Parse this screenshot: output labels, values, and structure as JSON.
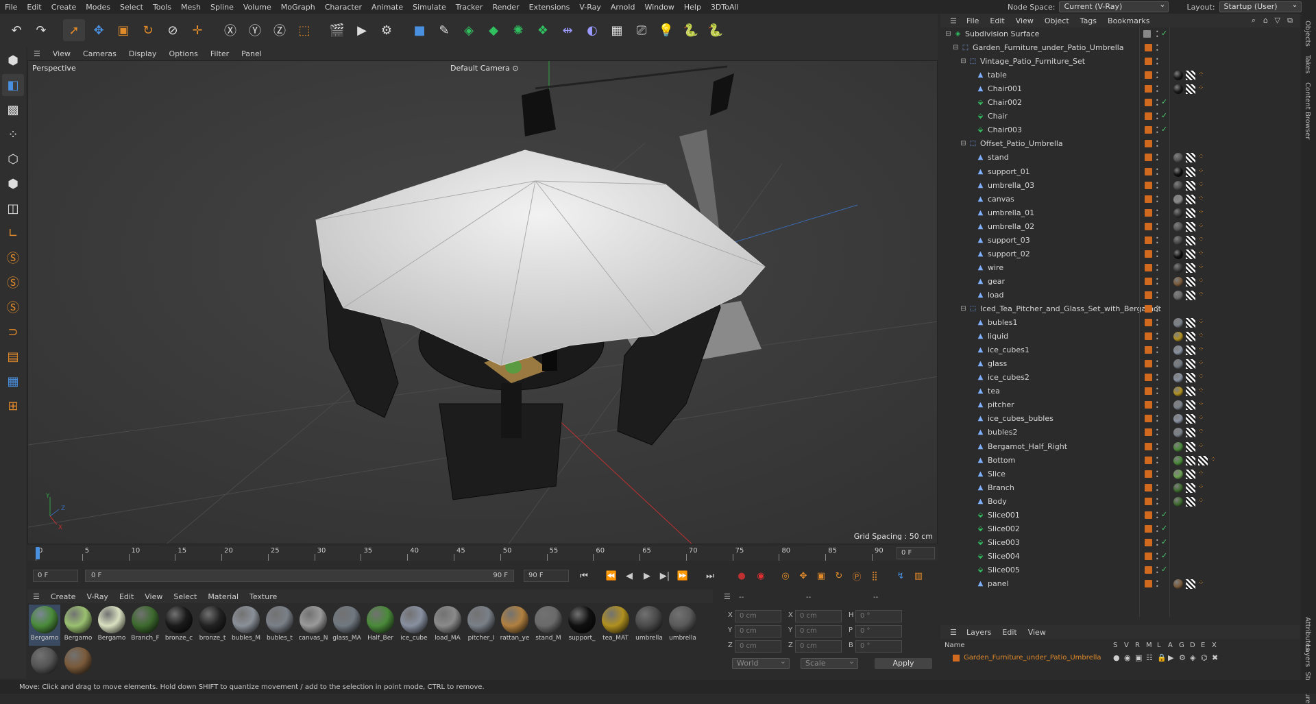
{
  "menubar": {
    "items": [
      "File",
      "Edit",
      "Create",
      "Modes",
      "Select",
      "Tools",
      "Mesh",
      "Spline",
      "Volume",
      "MoGraph",
      "Character",
      "Animate",
      "Simulate",
      "Tracker",
      "Render",
      "Extensions",
      "V-Ray",
      "Arnold",
      "Window",
      "Help",
      "3DToAll"
    ],
    "node_space_label": "Node Space:",
    "node_space_value": "Current (V-Ray)",
    "layout_label": "Layout:",
    "layout_value": "Startup (User)"
  },
  "toolbar": {
    "icons": [
      "undo-icon",
      "redo-icon",
      "select-arrow-icon",
      "move-icon",
      "scale-icon",
      "rotate-icon",
      "recent-tool-icon",
      "add-icon",
      "x-axis-icon",
      "y-axis-icon",
      "z-axis-icon",
      "coordinate-system-icon",
      "render-region-icon",
      "render-view-icon",
      "render-settings-icon",
      "cube-primitive-icon",
      "pen-spline-icon",
      "subdivision-icon",
      "extrude-icon",
      "cloner-icon",
      "array-icon",
      "symmetry-icon",
      "deformer-icon",
      "floor-icon",
      "camera-icon",
      "light-icon",
      "python-icon",
      "python-alt-icon"
    ]
  },
  "left_toolbar": {
    "icons": [
      "make-editable-icon",
      "model-mode-icon",
      "texture-mode-icon",
      "points-mode-icon",
      "edges-mode-icon",
      "polygons-mode-icon",
      "uv-mode-icon",
      "axis-mode-icon",
      "snap-s1-icon",
      "snap-s2-icon",
      "snap-s3-icon",
      "magnet-icon",
      "workplane-icon",
      "grid-icon",
      "lock-grid-icon"
    ]
  },
  "viewport_menu": {
    "items": [
      "View",
      "Cameras",
      "Display",
      "Options",
      "Filter",
      "Panel"
    ]
  },
  "viewport": {
    "view_name": "Perspective",
    "camera_name": "Default Camera",
    "grid_spacing": "Grid Spacing : 50 cm",
    "axis_labels": {
      "y": "Y",
      "z": "Z",
      "x": "X"
    }
  },
  "timeline": {
    "ticks": [
      "0",
      "5",
      "10",
      "15",
      "20",
      "25",
      "30",
      "35",
      "40",
      "45",
      "50",
      "55",
      "60",
      "65",
      "70",
      "75",
      "80",
      "85",
      "90"
    ],
    "current_frame": "0 F"
  },
  "transport": {
    "start_field": "0 F",
    "range_start": "0 F",
    "range_end": "90 F",
    "end_field": "90 F"
  },
  "material_menu": {
    "items": [
      "Create",
      "V-Ray",
      "Edit",
      "View",
      "Select",
      "Material",
      "Texture"
    ]
  },
  "materials": [
    {
      "name": "Bergamo",
      "color": "#4a8a3a"
    },
    {
      "name": "Bergamo",
      "color": "#9ac070"
    },
    {
      "name": "Bergamo",
      "color": "#d8e0c0"
    },
    {
      "name": "Branch_F",
      "color": "#3d6a2e"
    },
    {
      "name": "bronze_c",
      "color": "#1a1a1a"
    },
    {
      "name": "bronze_t",
      "color": "#222222"
    },
    {
      "name": "bubles_M",
      "color": "#8a9098"
    },
    {
      "name": "bubles_t",
      "color": "#7a8088"
    },
    {
      "name": "canvas_N",
      "color": "#9a9a9a"
    },
    {
      "name": "glass_MA",
      "color": "#707880"
    },
    {
      "name": "Half_Ber",
      "color": "#4a8a3a"
    },
    {
      "name": "ice_cube",
      "color": "#8890a0"
    },
    {
      "name": "load_MA",
      "color": "#8a8a8a"
    },
    {
      "name": "pitcher_I",
      "color": "#7a8088"
    },
    {
      "name": "rattan_ye",
      "color": "#b08040"
    },
    {
      "name": "stand_M",
      "color": "#6a6a6a"
    },
    {
      "name": "support_",
      "color": "#101010"
    },
    {
      "name": "tea_MAT",
      "color": "#b09020"
    },
    {
      "name": "umbrella",
      "color": "#4a4a4a"
    },
    {
      "name": "umbrella",
      "color": "#5a5a5a"
    },
    {
      "name": "",
      "color": "#555555"
    },
    {
      "name": "",
      "color": "#7a5a3a"
    }
  ],
  "coords": {
    "header": [
      "--",
      "--",
      "--"
    ],
    "rows": [
      {
        "a": "X",
        "av": "0 cm",
        "b": "X",
        "bv": "0 cm",
        "c": "H",
        "cv": "0 °"
      },
      {
        "a": "Y",
        "av": "0 cm",
        "b": "Y",
        "bv": "0 cm",
        "c": "P",
        "cv": "0 °"
      },
      {
        "a": "Z",
        "av": "0 cm",
        "b": "Z",
        "bv": "0 cm",
        "c": "B",
        "cv": "0 °"
      }
    ],
    "world": "World",
    "scale": "Scale",
    "apply": "Apply"
  },
  "status_text": "Move: Click and drag to move elements. Hold down SHIFT to quantize movement / add to the selection in point mode, CTRL to remove.",
  "object_menu": {
    "items": [
      "File",
      "Edit",
      "View",
      "Object",
      "Tags",
      "Bookmarks"
    ]
  },
  "objects": [
    {
      "name": "Subdivision Surface",
      "indent": 0,
      "type": "sds",
      "check": true,
      "tags": []
    },
    {
      "name": "Garden_Furniture_under_Patio_Umbrella",
      "indent": 1,
      "type": "null",
      "check": false,
      "tags": []
    },
    {
      "name": "Vintage_Patio_Furniture_Set",
      "indent": 2,
      "type": "null",
      "check": false,
      "tags": []
    },
    {
      "name": "table",
      "indent": 3,
      "type": "poly",
      "check": false,
      "tags": [
        "#1a1a1a"
      ]
    },
    {
      "name": "Chair001",
      "indent": 3,
      "type": "poly",
      "check": false,
      "tags": [
        "#1a1a1a"
      ]
    },
    {
      "name": "Chair002",
      "indent": 3,
      "type": "inst",
      "check": true,
      "tags": []
    },
    {
      "name": "Chair",
      "indent": 3,
      "type": "inst",
      "check": true,
      "tags": []
    },
    {
      "name": "Chair003",
      "indent": 3,
      "type": "inst",
      "check": true,
      "tags": []
    },
    {
      "name": "Offset_Patio_Umbrella",
      "indent": 2,
      "type": "null",
      "check": false,
      "tags": []
    },
    {
      "name": "stand",
      "indent": 3,
      "type": "poly",
      "check": false,
      "tags": [
        "#555555"
      ]
    },
    {
      "name": "support_01",
      "indent": 3,
      "type": "poly",
      "check": false,
      "tags": [
        "#111111"
      ]
    },
    {
      "name": "umbrella_03",
      "indent": 3,
      "type": "poly",
      "check": false,
      "tags": [
        "#4a4a4a"
      ]
    },
    {
      "name": "canvas",
      "indent": 3,
      "type": "poly",
      "check": false,
      "tags": [
        "#8a8a8a"
      ]
    },
    {
      "name": "umbrella_01",
      "indent": 3,
      "type": "poly",
      "check": false,
      "tags": [
        "#333333"
      ]
    },
    {
      "name": "umbrella_02",
      "indent": 3,
      "type": "poly",
      "check": false,
      "tags": [
        "#555555"
      ]
    },
    {
      "name": "support_03",
      "indent": 3,
      "type": "poly",
      "check": false,
      "tags": [
        "#444444"
      ]
    },
    {
      "name": "support_02",
      "indent": 3,
      "type": "poly",
      "check": false,
      "tags": [
        "#111111"
      ]
    },
    {
      "name": "wire",
      "indent": 3,
      "type": "poly",
      "check": false,
      "tags": [
        "#3a3a3a"
      ]
    },
    {
      "name": "gear",
      "indent": 3,
      "type": "poly",
      "check": false,
      "tags": [
        "#7a5a3a"
      ]
    },
    {
      "name": "load",
      "indent": 3,
      "type": "poly",
      "check": false,
      "tags": [
        "#6a6a6a"
      ]
    },
    {
      "name": "Iced_Tea_Pitcher_and_Glass_Set_with_Bergamot",
      "indent": 2,
      "type": "null",
      "check": false,
      "tags": []
    },
    {
      "name": "bubles1",
      "indent": 3,
      "type": "poly",
      "check": false,
      "tags": [
        "#7a8088"
      ]
    },
    {
      "name": "liquid",
      "indent": 3,
      "type": "poly",
      "check": false,
      "tags": [
        "#b09020"
      ]
    },
    {
      "name": "ice_cubes1",
      "indent": 3,
      "type": "poly",
      "check": false,
      "tags": [
        "#8890a0"
      ]
    },
    {
      "name": "glass",
      "indent": 3,
      "type": "poly",
      "check": false,
      "tags": [
        "#707880"
      ]
    },
    {
      "name": "ice_cubes2",
      "indent": 3,
      "type": "poly",
      "check": false,
      "tags": [
        "#8890a0"
      ]
    },
    {
      "name": "tea",
      "indent": 3,
      "type": "poly",
      "check": false,
      "tags": [
        "#b09020"
      ]
    },
    {
      "name": "pitcher",
      "indent": 3,
      "type": "poly",
      "check": false,
      "tags": [
        "#7a8088"
      ]
    },
    {
      "name": "ice_cubes_bubles",
      "indent": 3,
      "type": "poly",
      "check": false,
      "tags": [
        "#8890a0"
      ]
    },
    {
      "name": "bubles2",
      "indent": 3,
      "type": "poly",
      "check": false,
      "tags": [
        "#7a8088"
      ]
    },
    {
      "name": "Bergamot_Half_Right",
      "indent": 3,
      "type": "poly",
      "check": false,
      "tags": [
        "#4a8a3a"
      ]
    },
    {
      "name": "Bottom",
      "indent": 3,
      "type": "poly",
      "check": false,
      "tags": [
        "#4a8a3a"
      ]
    },
    {
      "name": "Slice",
      "indent": 3,
      "type": "poly",
      "check": false,
      "tags": [
        "#6aa050"
      ]
    },
    {
      "name": "Branch",
      "indent": 3,
      "type": "poly",
      "check": false,
      "tags": [
        "#3d6a2e"
      ]
    },
    {
      "name": "Body",
      "indent": 3,
      "type": "poly",
      "check": false,
      "tags": [
        "#3d6a2e"
      ]
    },
    {
      "name": "Slice001",
      "indent": 3,
      "type": "inst",
      "check": true,
      "tags": []
    },
    {
      "name": "Slice002",
      "indent": 3,
      "type": "inst",
      "check": true,
      "tags": []
    },
    {
      "name": "Slice003",
      "indent": 3,
      "type": "inst",
      "check": true,
      "tags": []
    },
    {
      "name": "Slice004",
      "indent": 3,
      "type": "inst",
      "check": true,
      "tags": []
    },
    {
      "name": "Slice005",
      "indent": 3,
      "type": "inst",
      "check": true,
      "tags": []
    },
    {
      "name": "panel",
      "indent": 3,
      "type": "poly",
      "check": false,
      "tags": [
        "#7a5a3a"
      ]
    }
  ],
  "layers": {
    "menu": [
      "Layers",
      "Edit",
      "View"
    ],
    "col_name": "Name",
    "cols": [
      "S",
      "V",
      "R",
      "M",
      "L",
      "A",
      "G",
      "D",
      "E",
      "X"
    ],
    "layer_name": "Garden_Furniture_under_Patio_Umbrella"
  },
  "right_tabs": [
    "Objects",
    "Takes",
    "Content Browser",
    "Attributes",
    "Layers",
    "Structure"
  ],
  "colors": {
    "accent": "#d16a1f",
    "active_blue": "#2b7bd0",
    "check_green": "#4ecb71"
  }
}
